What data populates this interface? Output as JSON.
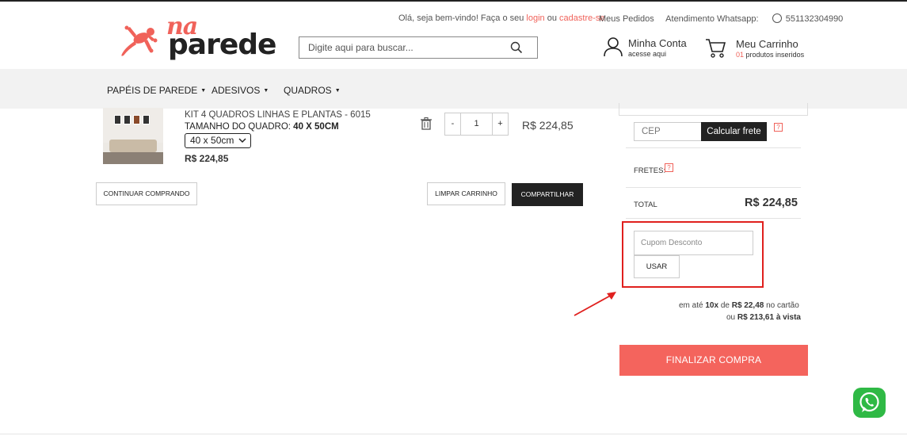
{
  "brand": {
    "logo_top": "na",
    "logo_bottom": "parede",
    "accent": "#f0625a"
  },
  "header": {
    "welcome_prefix": "Olá, seja bem-vindo! Faça o seu",
    "login": "login",
    "or": "ou",
    "signup": "cadastre-se",
    "my_orders": "Meus Pedidos",
    "whatsapp_label": "Atendimento Whatsapp:",
    "whatsapp_number": "551132304990",
    "search_placeholder": "Digite aqui para buscar...",
    "account_title": "Minha Conta",
    "account_sub": "acesse aqui",
    "cart_title": "Meu Carrinho",
    "cart_count": "01",
    "cart_sub": "produtos inseridos"
  },
  "nav": {
    "items": [
      {
        "label": "PAPÉIS DE PAREDE"
      },
      {
        "label": "ADESIVOS"
      },
      {
        "label": "QUADROS"
      }
    ]
  },
  "cart_item": {
    "name": "KIT 4 QUADROS LINHAS E PLANTAS - 6015",
    "size_label": "TAMANHO DO QUADRO:",
    "size_value": "40 X 50CM",
    "size_option": "40 x 50cm",
    "price": "R$ 224,85",
    "quantity": "1",
    "minus": "-",
    "plus": "+",
    "line_total": "R$ 224,85"
  },
  "actions": {
    "continue": "CONTINUAR COMPRANDO",
    "clear": "LIMPAR CARRINHO",
    "share": "COMPARTILHAR"
  },
  "summary": {
    "cep_placeholder": "CEP",
    "calc_shipping": "Calcular frete",
    "help": "?",
    "fretes_label": "FRETES:",
    "total_label": "TOTAL",
    "total_value": "R$ 224,85",
    "coupon_placeholder": "Cupom Desconto",
    "use_button": "USAR",
    "inst_prefix": "em até",
    "inst_count": "10x",
    "inst_de": "de",
    "inst_value": "R$ 22,48",
    "inst_suffix": "no cartão",
    "cash_prefix": "ou",
    "cash_value": "R$ 213,61 à vista",
    "checkout": "FINALIZAR COMPRA"
  },
  "colors": {
    "checkout_bg": "#f4645d",
    "dark_button": "#222222",
    "highlight": "#e0201e",
    "whatsapp": "#2fb945"
  }
}
